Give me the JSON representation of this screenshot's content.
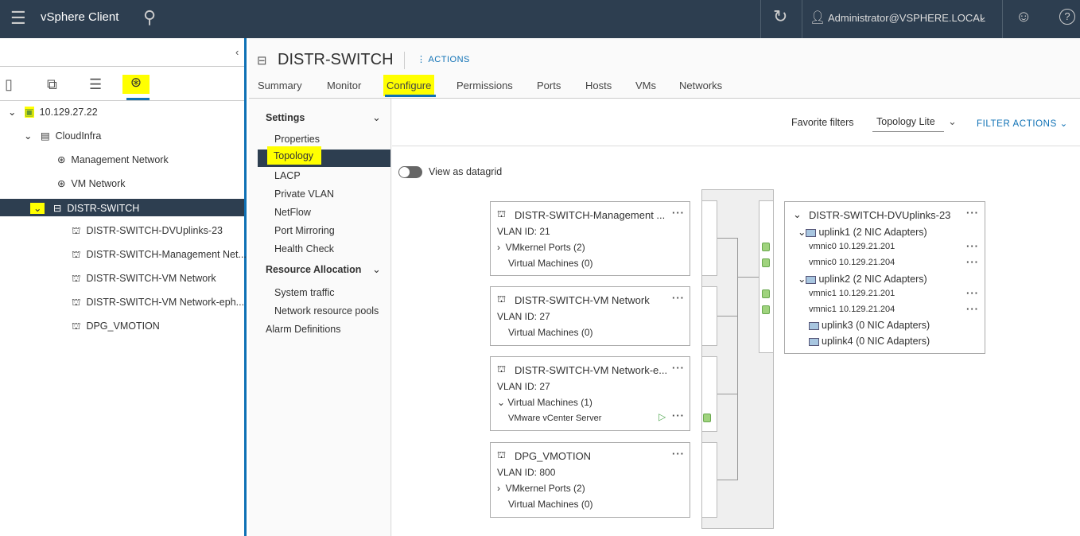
{
  "header": {
    "app_title": "vSphere Client",
    "user": "Administrator@VSPHERE.LOCAL"
  },
  "inventory": {
    "root": "10.129.27.22",
    "datacenter": "CloudInfra",
    "items": [
      "Management Network",
      "VM Network",
      "DISTR-SWITCH"
    ],
    "children": [
      "DISTR-SWITCH-DVUplinks-23",
      "DISTR-SWITCH-Management Net...",
      "DISTR-SWITCH-VM Network",
      "DISTR-SWITCH-VM Network-eph...",
      "DPG_VMOTION"
    ]
  },
  "object": {
    "title": "DISTR-SWITCH",
    "actions": "ACTIONS",
    "tabs": [
      "Summary",
      "Monitor",
      "Configure",
      "Permissions",
      "Ports",
      "Hosts",
      "VMs",
      "Networks"
    ]
  },
  "configure": {
    "settings": "Settings",
    "settings_items": [
      "Properties",
      "Topology",
      "LACP",
      "Private VLAN",
      "NetFlow",
      "Port Mirroring",
      "Health Check"
    ],
    "resource": "Resource Allocation",
    "resource_items": [
      "System traffic",
      "Network resource pools"
    ],
    "alarm": "Alarm Definitions"
  },
  "filters": {
    "favorite": "Favorite filters",
    "selected": "Topology Lite",
    "actions": "FILTER ACTIONS"
  },
  "toggle": {
    "label": "View as datagrid",
    "on": false
  },
  "portgroups": [
    {
      "name": "DISTR-SWITCH-Management ...",
      "vlan": "VLAN ID: 21",
      "lines": [
        "VMkernel Ports (2)",
        "Virtual Machines (0)"
      ]
    },
    {
      "name": "DISTR-SWITCH-VM Network",
      "vlan": "VLAN ID: 27",
      "lines": [
        "Virtual Machines (0)"
      ]
    },
    {
      "name": "DISTR-SWITCH-VM Network-e...",
      "vlan": "VLAN ID: 27",
      "lines": [
        "Virtual Machines (1)",
        "VMware vCenter Server"
      ]
    },
    {
      "name": "DPG_VMOTION",
      "vlan": "VLAN ID: 800",
      "lines": [
        "VMkernel Ports (2)",
        "Virtual Machines (0)"
      ]
    }
  ],
  "uplinks": {
    "name": "DISTR-SWITCH-DVUplinks-23",
    "rows": [
      "uplink1 (2 NIC Adapters)",
      "vmnic0 10.129.21.201",
      "vmnic0 10.129.21.204",
      "uplink2 (2 NIC Adapters)",
      "vmnic1 10.129.21.201",
      "vmnic1 10.129.21.204",
      "uplink3 (0 NIC Adapters)",
      "uplink4 (0 NIC Adapters)"
    ]
  }
}
